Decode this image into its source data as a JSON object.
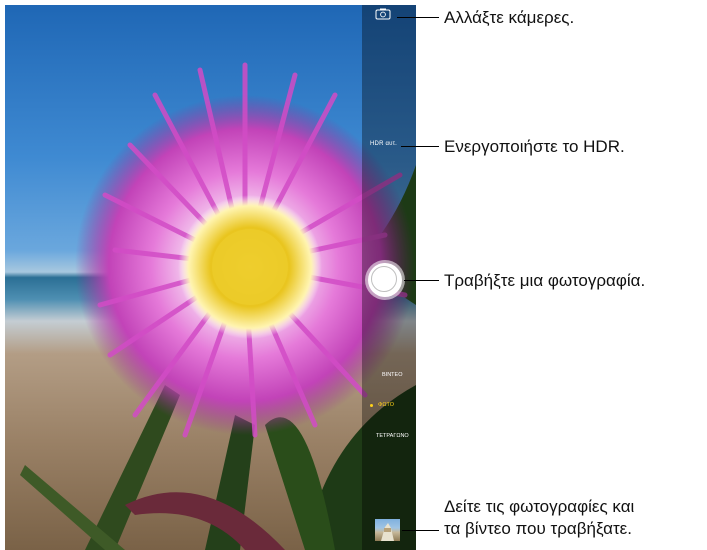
{
  "camera": {
    "hdr_label": "HDR αυτ.",
    "modes": [
      "ΒΙΝΤΕΟ",
      "ΦΩΤΟ",
      "ΤΕΤΡΑΓΩΝΟ"
    ],
    "selected_mode": "ΦΩΤΟ",
    "accent_color": "#ffd21a"
  },
  "icons": {
    "switch_camera": "camera-switch-icon",
    "shutter": "shutter-icon",
    "thumbnail": "photo-thumbnail-icon"
  },
  "callouts": {
    "switch_camera": "Αλλάξτε κάμερες.",
    "hdr": "Ενεργοποιήστε το HDR.",
    "shutter": "Τραβήξτε μια φωτογραφία.",
    "thumbnail_line1": "Δείτε τις φωτογραφίες και",
    "thumbnail_line2": "τα βίντεο που τραβήξατε."
  }
}
